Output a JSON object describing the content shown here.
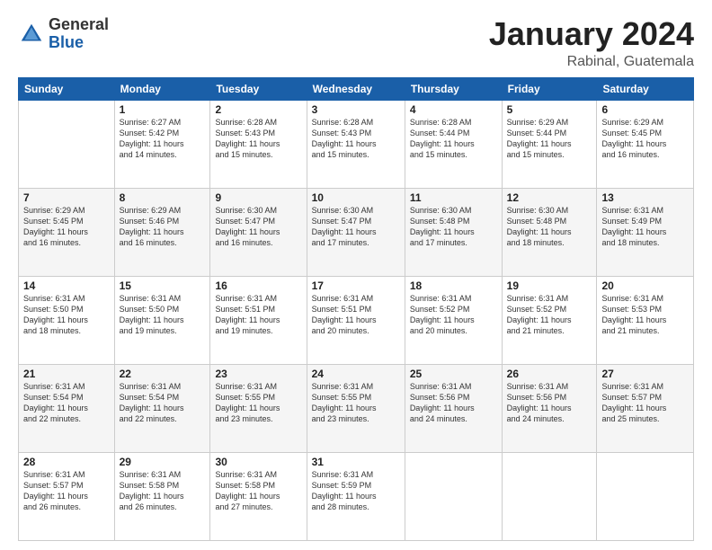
{
  "logo": {
    "general": "General",
    "blue": "Blue"
  },
  "title": {
    "month": "January 2024",
    "location": "Rabinal, Guatemala"
  },
  "weekdays": [
    "Sunday",
    "Monday",
    "Tuesday",
    "Wednesday",
    "Thursday",
    "Friday",
    "Saturday"
  ],
  "weeks": [
    [
      {
        "day": "",
        "info": ""
      },
      {
        "day": "1",
        "info": "Sunrise: 6:27 AM\nSunset: 5:42 PM\nDaylight: 11 hours\nand 14 minutes."
      },
      {
        "day": "2",
        "info": "Sunrise: 6:28 AM\nSunset: 5:43 PM\nDaylight: 11 hours\nand 15 minutes."
      },
      {
        "day": "3",
        "info": "Sunrise: 6:28 AM\nSunset: 5:43 PM\nDaylight: 11 hours\nand 15 minutes."
      },
      {
        "day": "4",
        "info": "Sunrise: 6:28 AM\nSunset: 5:44 PM\nDaylight: 11 hours\nand 15 minutes."
      },
      {
        "day": "5",
        "info": "Sunrise: 6:29 AM\nSunset: 5:44 PM\nDaylight: 11 hours\nand 15 minutes."
      },
      {
        "day": "6",
        "info": "Sunrise: 6:29 AM\nSunset: 5:45 PM\nDaylight: 11 hours\nand 16 minutes."
      }
    ],
    [
      {
        "day": "7",
        "info": "Sunrise: 6:29 AM\nSunset: 5:45 PM\nDaylight: 11 hours\nand 16 minutes."
      },
      {
        "day": "8",
        "info": "Sunrise: 6:29 AM\nSunset: 5:46 PM\nDaylight: 11 hours\nand 16 minutes."
      },
      {
        "day": "9",
        "info": "Sunrise: 6:30 AM\nSunset: 5:47 PM\nDaylight: 11 hours\nand 16 minutes."
      },
      {
        "day": "10",
        "info": "Sunrise: 6:30 AM\nSunset: 5:47 PM\nDaylight: 11 hours\nand 17 minutes."
      },
      {
        "day": "11",
        "info": "Sunrise: 6:30 AM\nSunset: 5:48 PM\nDaylight: 11 hours\nand 17 minutes."
      },
      {
        "day": "12",
        "info": "Sunrise: 6:30 AM\nSunset: 5:48 PM\nDaylight: 11 hours\nand 18 minutes."
      },
      {
        "day": "13",
        "info": "Sunrise: 6:31 AM\nSunset: 5:49 PM\nDaylight: 11 hours\nand 18 minutes."
      }
    ],
    [
      {
        "day": "14",
        "info": "Sunrise: 6:31 AM\nSunset: 5:50 PM\nDaylight: 11 hours\nand 18 minutes."
      },
      {
        "day": "15",
        "info": "Sunrise: 6:31 AM\nSunset: 5:50 PM\nDaylight: 11 hours\nand 19 minutes."
      },
      {
        "day": "16",
        "info": "Sunrise: 6:31 AM\nSunset: 5:51 PM\nDaylight: 11 hours\nand 19 minutes."
      },
      {
        "day": "17",
        "info": "Sunrise: 6:31 AM\nSunset: 5:51 PM\nDaylight: 11 hours\nand 20 minutes."
      },
      {
        "day": "18",
        "info": "Sunrise: 6:31 AM\nSunset: 5:52 PM\nDaylight: 11 hours\nand 20 minutes."
      },
      {
        "day": "19",
        "info": "Sunrise: 6:31 AM\nSunset: 5:52 PM\nDaylight: 11 hours\nand 21 minutes."
      },
      {
        "day": "20",
        "info": "Sunrise: 6:31 AM\nSunset: 5:53 PM\nDaylight: 11 hours\nand 21 minutes."
      }
    ],
    [
      {
        "day": "21",
        "info": "Sunrise: 6:31 AM\nSunset: 5:54 PM\nDaylight: 11 hours\nand 22 minutes."
      },
      {
        "day": "22",
        "info": "Sunrise: 6:31 AM\nSunset: 5:54 PM\nDaylight: 11 hours\nand 22 minutes."
      },
      {
        "day": "23",
        "info": "Sunrise: 6:31 AM\nSunset: 5:55 PM\nDaylight: 11 hours\nand 23 minutes."
      },
      {
        "day": "24",
        "info": "Sunrise: 6:31 AM\nSunset: 5:55 PM\nDaylight: 11 hours\nand 23 minutes."
      },
      {
        "day": "25",
        "info": "Sunrise: 6:31 AM\nSunset: 5:56 PM\nDaylight: 11 hours\nand 24 minutes."
      },
      {
        "day": "26",
        "info": "Sunrise: 6:31 AM\nSunset: 5:56 PM\nDaylight: 11 hours\nand 24 minutes."
      },
      {
        "day": "27",
        "info": "Sunrise: 6:31 AM\nSunset: 5:57 PM\nDaylight: 11 hours\nand 25 minutes."
      }
    ],
    [
      {
        "day": "28",
        "info": "Sunrise: 6:31 AM\nSunset: 5:57 PM\nDaylight: 11 hours\nand 26 minutes."
      },
      {
        "day": "29",
        "info": "Sunrise: 6:31 AM\nSunset: 5:58 PM\nDaylight: 11 hours\nand 26 minutes."
      },
      {
        "day": "30",
        "info": "Sunrise: 6:31 AM\nSunset: 5:58 PM\nDaylight: 11 hours\nand 27 minutes."
      },
      {
        "day": "31",
        "info": "Sunrise: 6:31 AM\nSunset: 5:59 PM\nDaylight: 11 hours\nand 28 minutes."
      },
      {
        "day": "",
        "info": ""
      },
      {
        "day": "",
        "info": ""
      },
      {
        "day": "",
        "info": ""
      }
    ]
  ]
}
